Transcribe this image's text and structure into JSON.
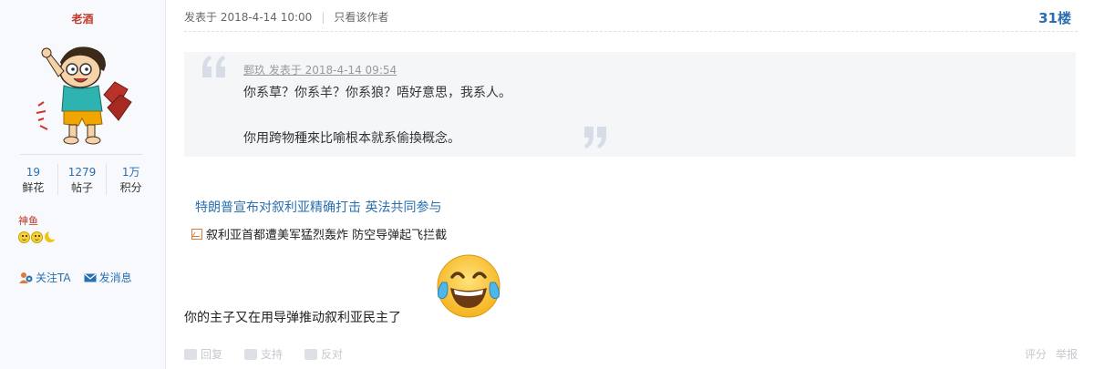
{
  "user": {
    "name": "老酒",
    "rank_title": "神鱼",
    "stats": [
      {
        "value": "19",
        "label": "鲜花"
      },
      {
        "value": "1279",
        "label": "帖子"
      },
      {
        "value": "1万",
        "label": "积分"
      }
    ],
    "follow_label": "关注TA",
    "message_label": "发消息"
  },
  "post": {
    "posted_label": "发表于 2018-4-14 10:00",
    "only_author_label": "只看该作者",
    "floor": "31楼",
    "quote": {
      "header": "鄄玖 发表于 2018-4-14 09:54",
      "line1": "你系草？你系羊？你系狼？唔好意思，我系人。",
      "line2": "你用跨物種來比喻根本就系偷換概念。"
    },
    "news_link": "特朗普宣布对叙利亚精确打击 英法共同参与",
    "image_caption": "叙利亚首都遭美军猛烈轰炸 防空导弹起飞拦截",
    "reply_text": "你的主子又在用导弹推动叙利亚民主了"
  },
  "actions": {
    "reply": "回复",
    "support": "支持",
    "oppose": "反对",
    "rate": "评分",
    "report": "举报"
  },
  "colors": {
    "accent": "#2a6fb0",
    "username": "#c0392b",
    "quote_bg": "#f4f6f8"
  }
}
